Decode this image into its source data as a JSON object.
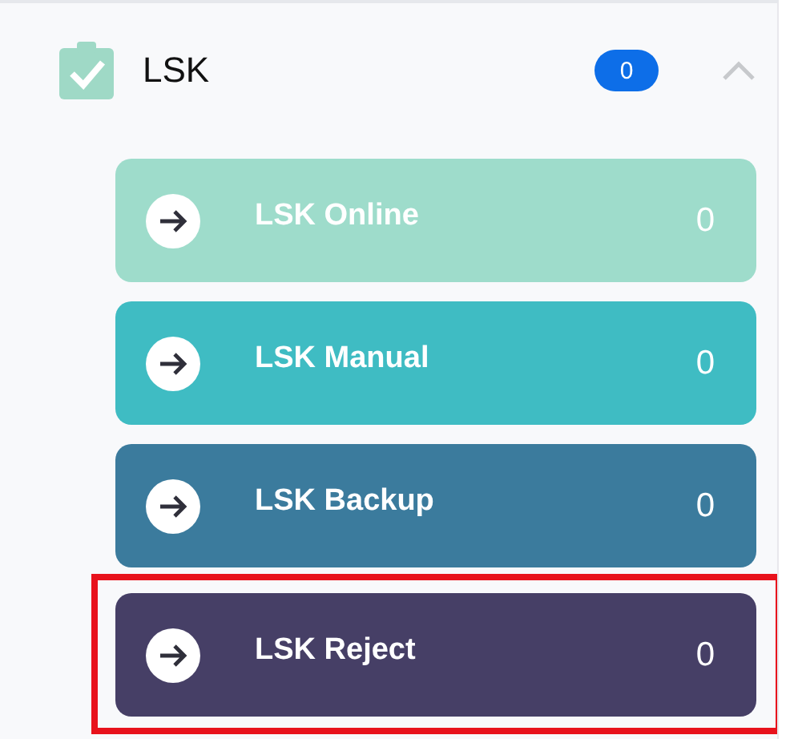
{
  "group": {
    "title": "LSK",
    "badge": "0",
    "expanded": true
  },
  "items": [
    {
      "label": "LSK Online",
      "count": "0",
      "color": "#9edccb",
      "highlighted": false
    },
    {
      "label": "LSK Manual",
      "count": "0",
      "color": "#3fbcc3",
      "highlighted": false
    },
    {
      "label": "LSK Backup",
      "count": "0",
      "color": "#3b7b9d",
      "highlighted": false
    },
    {
      "label": "LSK Reject",
      "count": "0",
      "color": "#463f66",
      "highlighted": true
    }
  ]
}
